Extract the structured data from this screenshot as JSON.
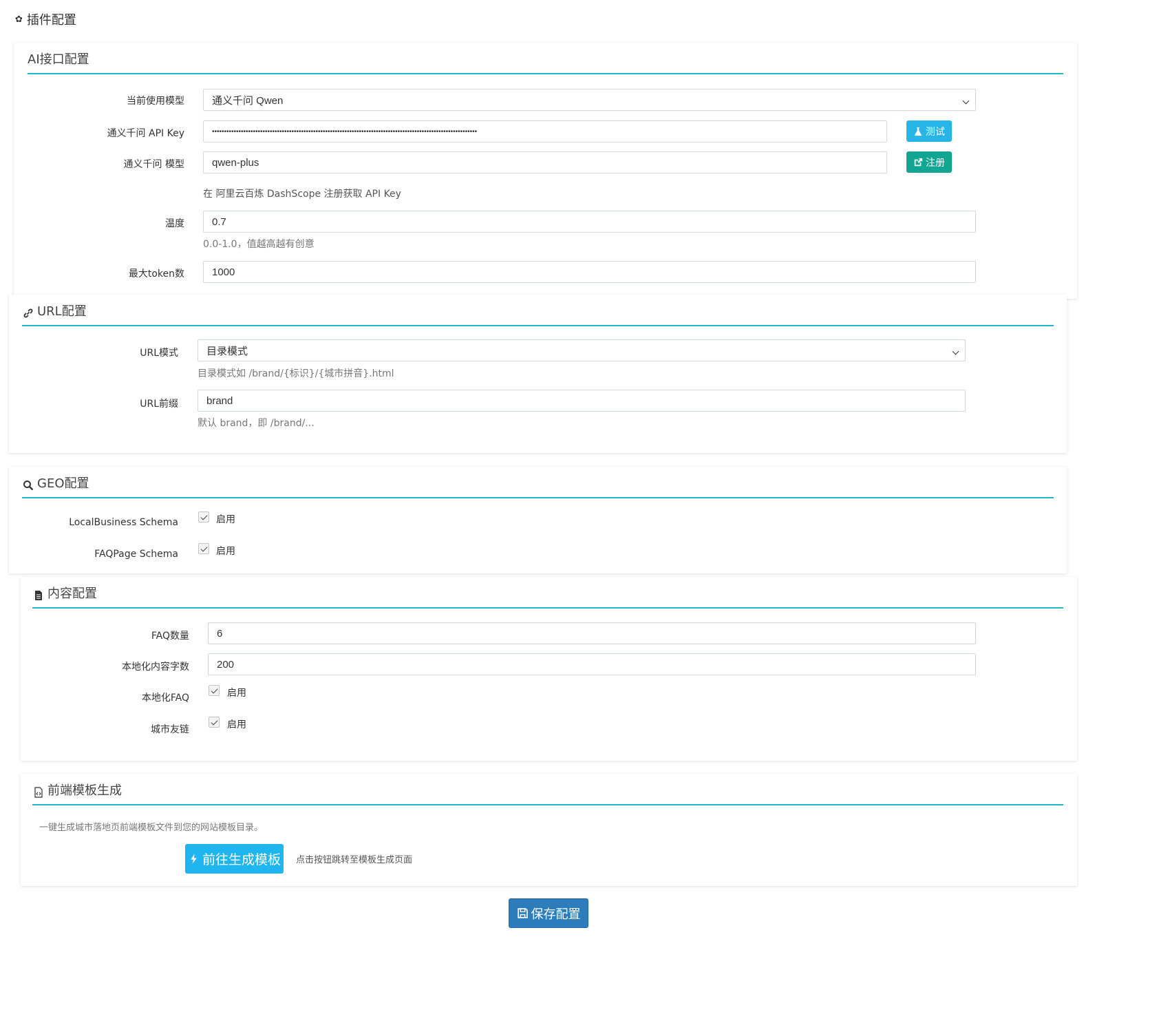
{
  "page_title": "插件配置",
  "ai_section": {
    "title": "AI接口配置",
    "model_label": "当前使用模型",
    "model_value": "通义千问 Qwen",
    "apikey_label": "通义千问 API Key",
    "apikey_value": "••••••••••••••••••••••••••••••••••••••••••••••••••••••••••••••••••••••••••••••••••••••••••••••••••••••••••••••",
    "test_button": "测试",
    "model_name_label": "通义千问 模型",
    "model_name_value": "qwen-plus",
    "register_button": "注册",
    "register_hint": "在 阿里云百炼 DashScope 注册获取 API Key",
    "temperature_label": "温度",
    "temperature_value": "0.7",
    "temperature_help": "0.0-1.0，值越高越有创意",
    "max_tokens_label": "最大token数",
    "max_tokens_value": "1000"
  },
  "url_section": {
    "title": "URL配置",
    "mode_label": "URL模式",
    "mode_value": "目录模式",
    "mode_help": "目录模式如 /brand/{标识}/{城市拼音}.html",
    "prefix_label": "URL前缀",
    "prefix_value": "brand",
    "prefix_help": "默认 brand，即 /brand/..."
  },
  "geo_section": {
    "title": "GEO配置",
    "local_business_label": "LocalBusiness Schema",
    "local_business_checkbox": "启用",
    "faqpage_label": "FAQPage Schema",
    "faqpage_checkbox": "启用"
  },
  "content_section": {
    "title": "内容配置",
    "faq_count_label": "FAQ数量",
    "faq_count_value": "6",
    "local_words_label": "本地化内容字数",
    "local_words_value": "200",
    "local_faq_label": "本地化FAQ",
    "local_faq_checkbox": "启用",
    "city_links_label": "城市友链",
    "city_links_checkbox": "启用"
  },
  "template_section": {
    "title": "前端模板生成",
    "description": "一键生成城市落地页前端模板文件到您的网站模板目录。",
    "generate_button": "前往生成模板",
    "generate_hint": "点击按钮跳转至模板生成页面"
  },
  "save_button": "保存配置",
  "colors": {
    "accent_line": "#23b7c8",
    "btn_info": "#27b4e6",
    "btn_success": "#12a592",
    "btn_primary": "#2d7dbd"
  }
}
